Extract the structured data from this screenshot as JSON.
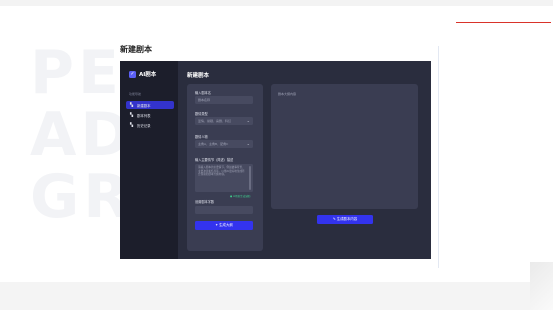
{
  "page": {
    "heading": "新建剧本",
    "watermark_lines": [
      "PE",
      "AD",
      "GR"
    ]
  },
  "app": {
    "logo": {
      "icon": "check-icon",
      "text": "AI剧本"
    },
    "sidebar": {
      "section_label": "功能导航",
      "items": [
        {
          "label": "新建剧本",
          "icon": "grid-icon",
          "active": true
        },
        {
          "label": "剧本列表",
          "icon": "grid-icon",
          "active": false
        },
        {
          "label": "历史记录",
          "icon": "grid-icon",
          "active": false
        }
      ]
    },
    "main_title": "新建剧本",
    "form": {
      "fields": [
        {
          "label": "输入剧本名",
          "placeholder": "剧本名称"
        },
        {
          "label": "剧情类型",
          "value": "爱情、悬疑、喜剧、科幻"
        },
        {
          "label": "剧情人物",
          "value": "主角A、主角B、配角C"
        }
      ],
      "story_label": "输入主要情节（简述）描述",
      "story_text": "请输入剧本的主要情节，例如故事背景、主要冲突和结局等，以便AI更好地生成符合预期的剧本大纲内容。",
      "ai_hint": "● AI智能生成辅助",
      "word_count_label": "设置剧本字数",
      "generate_outline": "✦ 生成大纲"
    },
    "output": {
      "label": "剧本大纲内容",
      "generate_script": "✎ 生成剧本内容"
    },
    "colors": {
      "accent": "#3333ee",
      "sidebar_bg": "#1c1e2b",
      "panel_bg": "#3a3d52"
    }
  }
}
